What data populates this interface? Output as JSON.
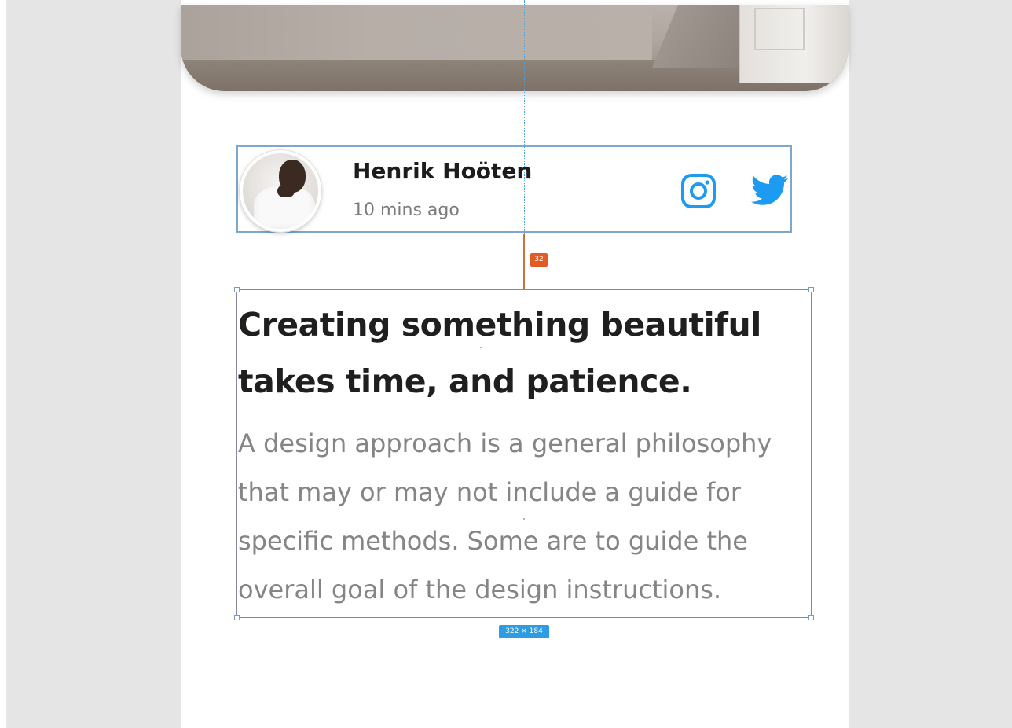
{
  "author": {
    "name": "Henrik Hoöten",
    "time": "10 mins ago",
    "avatar_icon": "avatar-photo",
    "social": [
      {
        "name": "instagram-icon",
        "color": "#1d9bf0"
      },
      {
        "name": "twitter-icon",
        "color": "#1d9bf0"
      }
    ]
  },
  "article": {
    "title": "Creating something beautiful takes time, and patience.",
    "body": "A design approach is a general philosophy that may or may not include a guide for specific methods. Some are to guide the overall goal of the design instructions."
  },
  "measurements": {
    "spacing_label": "32",
    "size_label": "322 × 184"
  },
  "colors": {
    "canvas_bg": "#e5e5e5",
    "selection_border": "#7ea6cf",
    "spacing_badge": "#e25b25",
    "size_badge": "#2d9ce0",
    "title_text": "#1f1f1f",
    "body_text": "#858585"
  }
}
